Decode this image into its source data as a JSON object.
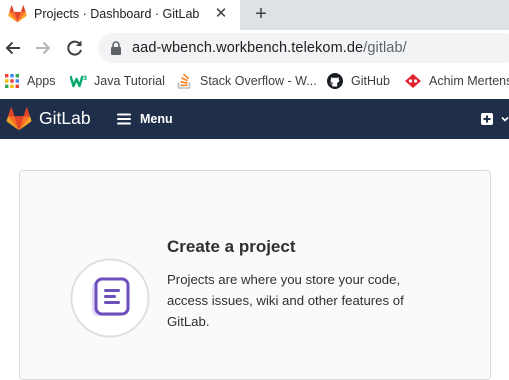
{
  "browser": {
    "tab": {
      "title": "Projects · Dashboard · GitLab",
      "close": "✕"
    },
    "new_tab": "+",
    "address_bar": {
      "host": "aad-wbench.workbench.telekom.de",
      "path": "/gitlab/"
    },
    "bookmarks": [
      {
        "label": "Apps",
        "icon": "apps-grid-icon"
      },
      {
        "label": "Java Tutorial",
        "icon": "w3schools-icon"
      },
      {
        "label": "Stack Overflow - W...",
        "icon": "stackoverflow-icon"
      },
      {
        "label": "GitHub",
        "icon": "github-icon"
      },
      {
        "label": "Achim Mertens",
        "icon": "profile-logo-icon"
      }
    ]
  },
  "gitlab": {
    "brand": "GitLab",
    "menu_label": "Menu",
    "header_color": "#1f2f4a"
  },
  "card": {
    "title": "Create a project",
    "description": "Projects are where you store your code, access issues, wiki and other features of GitLab."
  },
  "colors": {
    "gitlab_orange": "#fc6d26",
    "icon_purple": "#6b4fbb",
    "icon_purple_light": "#e1d8f9"
  }
}
